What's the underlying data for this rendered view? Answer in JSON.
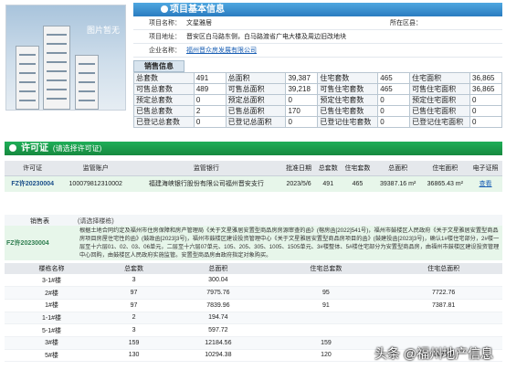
{
  "photo": {
    "label": "图片暂无"
  },
  "project": {
    "title": "项目基本信息",
    "fields": [
      {
        "label": "项目名称：",
        "value": "文星雅居",
        "label2": "所在区县：",
        "value2": ""
      },
      {
        "label": "项目地址：",
        "value": "晋安区白马路东侧，白马路渡省广电大楼及周边旧改地块",
        "label2": "",
        "value2": ""
      },
      {
        "label": "企业名称：",
        "value": "福州晋众房发展有限公司",
        "label2": "",
        "value2": ""
      }
    ]
  },
  "sales_info": {
    "label": "销售信息",
    "rows": [
      [
        "总套数",
        "491",
        "总面积",
        "39,387",
        "住宅套数",
        "465",
        "住宅面积",
        "36,865"
      ],
      [
        "可售总套数",
        "489",
        "可售总面积",
        "39,218",
        "可售住宅套数",
        "465",
        "可售住宅面积",
        "36,865"
      ],
      [
        "预定总套数",
        "0",
        "预定总面积",
        "0",
        "预定住宅套数",
        "0",
        "预定住宅面积",
        "0"
      ],
      [
        "已售总套数",
        "2",
        "已售总面积",
        "170",
        "已售住宅套数",
        "0",
        "已售住宅面积",
        "0"
      ],
      [
        "已登记总套数",
        "0",
        "已登记总面积",
        "0",
        "已登记住宅套数",
        "0",
        "已登记住宅面积",
        "0"
      ]
    ]
  },
  "permit": {
    "title": "许可证",
    "subtitle": "(请选择许可证)",
    "headers": [
      "许可证",
      "监管账户",
      "监管银行",
      "批准日期",
      "总套数",
      "住宅套数",
      "总面积",
      "住宅面积",
      "电子证照"
    ],
    "row": [
      "FZ许20230004",
      "100079812310002",
      "福建海峡银行股份有限公司福州晋安支行",
      "2023/5/6",
      "491",
      "465",
      "39387.16 m²",
      "36865.43 m²",
      "查看"
    ]
  },
  "sales_scope": {
    "label": "销售表",
    "hint": "(请选择楼栋)",
    "code": "FZ许20230004",
    "text": "根据土地合同约定及福州市住房保障和房产管理局《关于文星雅居安置型商品房房源审查的函》(榕房函[2022]541号)，福州市鼓楼区人民政府《关于文星雅居安置型商品房项目房屋住宅性的函》(鼓政函[2023]3号)，福州市鼓楼区建设投资管理中心《关于文星雅居安置型商品房项目的函》(鼓建投函[2023]3号)，确认1#楼住宅部分，2#楼一层至十六层01、02、03、06单元，二层至十六层07单元、105、205、305、1005、1505单元、3#楼整体、5#楼住宅部分为安置型商品房，由福州市鼓楼区建设投资管理中心回购，由鼓楼区人民政府实施监管。安置型商品房由政府指定对象购买。"
  },
  "buildings": {
    "headers": [
      "楼栋名称",
      "总套数",
      "总面积",
      "住宅总套数",
      "住宅总面积"
    ],
    "rows": [
      [
        "3-1#楼",
        "3",
        "300.04",
        "",
        ""
      ],
      [
        "2#楼",
        "97",
        "7975.76",
        "95",
        "7722.76"
      ],
      [
        "1#楼",
        "97",
        "7839.96",
        "91",
        "7387.81"
      ],
      [
        "1-1#楼",
        "2",
        "194.74",
        "",
        ""
      ],
      [
        "5-1#楼",
        "3",
        "597.72",
        "",
        ""
      ],
      [
        "3#楼",
        "159",
        "12184.56",
        "159",
        ""
      ],
      [
        "5#楼",
        "130",
        "10294.38",
        "120",
        "9670.3"
      ]
    ]
  },
  "watermark": {
    "prefix": "头条",
    "name": "@福州地产信息"
  }
}
